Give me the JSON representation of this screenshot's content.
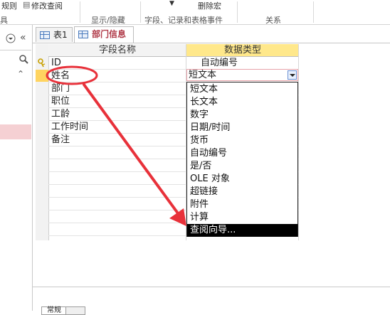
{
  "ribbon": {
    "left_item": "规则",
    "left_cmd": "修改查阅",
    "group_left": "具",
    "groups": [
      "显示/隐藏",
      "字段、记录和表格事件",
      "关系"
    ],
    "delete_macro": "删除宏",
    "small_arrow": "▼"
  },
  "nav": {
    "menu_icon": "dropdown-circle-icon",
    "collapse_label": "«",
    "search_icon": "search-icon",
    "scroll_up_label": "⌃"
  },
  "tabs": [
    {
      "label": "表1",
      "active": false
    },
    {
      "label": "部门信息",
      "active": true
    }
  ],
  "grid": {
    "header_field": "字段名称",
    "header_type": "数据类型",
    "rows": [
      {
        "name": "ID",
        "type": "自动编号",
        "key": true
      },
      {
        "name": "姓名",
        "type": "短文本",
        "key": false
      },
      {
        "name": "部门",
        "type": "",
        "key": false
      },
      {
        "name": "职位",
        "type": "",
        "key": false
      },
      {
        "name": "工龄",
        "type": "",
        "key": false
      },
      {
        "name": "工作时间",
        "type": "",
        "key": false
      },
      {
        "name": "备注",
        "type": "",
        "key": false
      }
    ]
  },
  "combo": {
    "value": "短文本"
  },
  "dropdown_options": [
    "短文本",
    "长文本",
    "数字",
    "日期/时间",
    "货币",
    "自动编号",
    "是/否",
    "OLE 对象",
    "超链接",
    "附件",
    "计算",
    "查阅向导..."
  ],
  "selected_option_index": 11,
  "bottom_tab": "常规",
  "colors": {
    "annotation": "#e8313a",
    "active_header": "#ffe88b",
    "active_tab": "#b03a48"
  }
}
